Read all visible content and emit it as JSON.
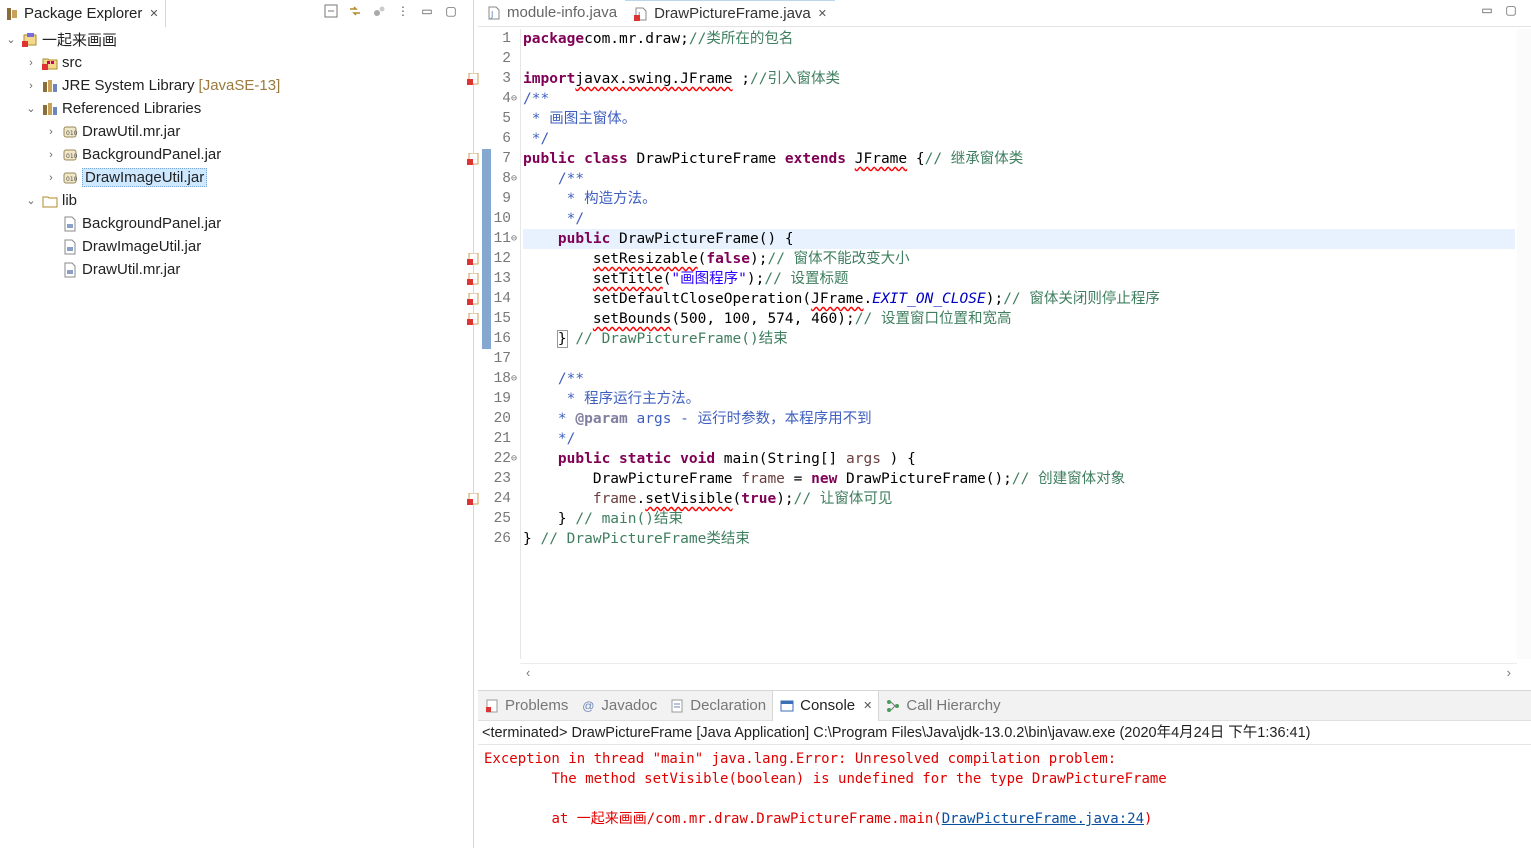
{
  "package_explorer": {
    "title": "Package Explorer",
    "tree": [
      {
        "label": "一起来画画",
        "depth": 0,
        "expanded": true,
        "icon": "java-project-error-icon"
      },
      {
        "label": "src",
        "depth": 1,
        "expanded": false,
        "icon": "source-folder-error-icon"
      },
      {
        "label": "JRE System Library",
        "suffix": "[JavaSE-13]",
        "depth": 1,
        "expanded": false,
        "icon": "library-icon"
      },
      {
        "label": "Referenced Libraries",
        "depth": 1,
        "expanded": true,
        "icon": "library-icon"
      },
      {
        "label": "DrawUtil.mr.jar",
        "depth": 2,
        "expanded": false,
        "icon": "jar-icon"
      },
      {
        "label": "BackgroundPanel.jar",
        "depth": 2,
        "expanded": false,
        "icon": "jar-icon"
      },
      {
        "label": "DrawImageUtil.jar",
        "depth": 2,
        "expanded": false,
        "icon": "jar-icon",
        "selected": true
      },
      {
        "label": "lib",
        "depth": 1,
        "expanded": true,
        "icon": "folder-icon"
      },
      {
        "label": "BackgroundPanel.jar",
        "depth": 2,
        "icon": "jar-file-icon"
      },
      {
        "label": "DrawImageUtil.jar",
        "depth": 2,
        "icon": "jar-file-icon"
      },
      {
        "label": "DrawUtil.mr.jar",
        "depth": 2,
        "icon": "jar-file-icon"
      }
    ]
  },
  "editor": {
    "tabs": [
      {
        "label": "module-info.java",
        "active": false
      },
      {
        "label": "DrawPictureFrame.java",
        "active": true
      }
    ],
    "lines": [
      {
        "n": "1",
        "tokens": [
          [
            "kw",
            "package"
          ],
          [
            "",
            "com.mr.draw;"
          ],
          [
            "cm",
            "//类所在的包名"
          ]
        ]
      },
      {
        "n": "2",
        "tokens": []
      },
      {
        "n": "3",
        "error": true,
        "tokens": [
          [
            "kw",
            "import"
          ],
          [
            "err",
            "javax.swing.JFrame"
          ],
          [
            "",
            " ;"
          ],
          [
            "cm",
            "//引入窗体类"
          ]
        ]
      },
      {
        "n": "4",
        "fold": true,
        "tokens": [
          [
            "jd",
            "/**"
          ]
        ]
      },
      {
        "n": "5",
        "tokens": [
          [
            "jd",
            " * 画图主窗体。"
          ]
        ]
      },
      {
        "n": "6",
        "tokens": [
          [
            "jd",
            " */"
          ]
        ]
      },
      {
        "n": "7",
        "error": true,
        "tokens": [
          [
            "kw",
            "public class"
          ],
          [
            "",
            " DrawPictureFrame "
          ],
          [
            "kw",
            "extends"
          ],
          [
            "",
            " "
          ],
          [
            "err",
            "JFrame"
          ],
          [
            "",
            " {"
          ],
          [
            "cm",
            "// 继承窗体类"
          ]
        ]
      },
      {
        "n": "8",
        "fold": true,
        "tokens": [
          [
            "jd",
            "    /**"
          ]
        ]
      },
      {
        "n": "9",
        "tokens": [
          [
            "jd",
            "     * 构造方法。"
          ]
        ]
      },
      {
        "n": "10",
        "tokens": [
          [
            "jd",
            "     */"
          ]
        ]
      },
      {
        "n": "11",
        "fold": true,
        "hl": true,
        "tokens": [
          [
            "",
            "    "
          ],
          [
            "kw",
            "public"
          ],
          [
            "",
            " DrawPictureFrame() {"
          ]
        ]
      },
      {
        "n": "12",
        "error": true,
        "tokens": [
          [
            "",
            "        "
          ],
          [
            "err",
            "setResizable"
          ],
          [
            "",
            "("
          ],
          [
            "kw",
            "false"
          ],
          [
            "",
            ");"
          ],
          [
            "cm",
            "// 窗体不能改变大小"
          ]
        ]
      },
      {
        "n": "13",
        "error": true,
        "tokens": [
          [
            "",
            "        "
          ],
          [
            "err",
            "setTitle"
          ],
          [
            "",
            "("
          ],
          [
            "str",
            "\"画图程序\""
          ],
          [
            "",
            ");"
          ],
          [
            "cm",
            "// 设置标题"
          ]
        ]
      },
      {
        "n": "14",
        "error": true,
        "tokens": [
          [
            "",
            "        setDefaultCloseOperation("
          ],
          [
            "err",
            "JFrame"
          ],
          [
            "",
            "."
          ],
          [
            "field",
            "EXIT_ON_CLOSE"
          ],
          [
            "",
            ");"
          ],
          [
            "cm",
            "// 窗体关闭则停止程序"
          ]
        ]
      },
      {
        "n": "15",
        "error": true,
        "tokens": [
          [
            "",
            "        "
          ],
          [
            "err",
            "setBounds"
          ],
          [
            "",
            "(500, 100, 574, 460);"
          ],
          [
            "cm",
            "// 设置窗口位置和宽高"
          ]
        ]
      },
      {
        "n": "16",
        "tokens": [
          [
            "",
            "    "
          ],
          [
            "box",
            "}"
          ],
          [
            "cm",
            " // DrawPictureFrame()结束"
          ]
        ]
      },
      {
        "n": "17",
        "tokens": []
      },
      {
        "n": "18",
        "fold": true,
        "tokens": [
          [
            "jd",
            "    /**"
          ]
        ]
      },
      {
        "n": "19",
        "tokens": [
          [
            "jd",
            "     * 程序运行主方法。"
          ]
        ]
      },
      {
        "n": "20",
        "tokens": [
          [
            "jd",
            "    * "
          ],
          [
            "tag",
            "@param"
          ],
          [
            "jd",
            " args - 运行时参数，本程序用不到"
          ]
        ]
      },
      {
        "n": "21",
        "tokens": [
          [
            "jd",
            "    */"
          ]
        ]
      },
      {
        "n": "22",
        "fold": true,
        "tokens": [
          [
            "",
            "    "
          ],
          [
            "kw",
            "public static void"
          ],
          [
            "",
            " main(String[] "
          ],
          [
            "var",
            "args"
          ],
          [
            "",
            " ) {"
          ]
        ]
      },
      {
        "n": "23",
        "tokens": [
          [
            "",
            "        DrawPictureFrame "
          ],
          [
            "var",
            "frame"
          ],
          [
            "",
            " = "
          ],
          [
            "kw",
            "new"
          ],
          [
            "",
            " DrawPictureFrame();"
          ],
          [
            "cm",
            "// 创建窗体对象"
          ]
        ]
      },
      {
        "n": "24",
        "error": true,
        "tokens": [
          [
            "",
            "        "
          ],
          [
            "var",
            "frame"
          ],
          [
            "",
            "."
          ],
          [
            "err",
            "setVisible"
          ],
          [
            "",
            "("
          ],
          [
            "kw",
            "true"
          ],
          [
            "",
            ");"
          ],
          [
            "cm",
            "// 让窗体可见"
          ]
        ]
      },
      {
        "n": "25",
        "tokens": [
          [
            "",
            "    } "
          ],
          [
            "cm",
            "// main()结束"
          ]
        ]
      },
      {
        "n": "26",
        "tokens": [
          [
            "",
            "} "
          ],
          [
            "cm",
            "// DrawPictureFrame类结束"
          ]
        ]
      }
    ]
  },
  "bottom_panel": {
    "tabs": [
      {
        "label": "Problems",
        "icon": "problems-icon",
        "active": false
      },
      {
        "label": "Javadoc",
        "icon": "javadoc-icon",
        "active": false
      },
      {
        "label": "Declaration",
        "icon": "declaration-icon",
        "active": false
      },
      {
        "label": "Console",
        "icon": "console-icon",
        "active": true
      },
      {
        "label": "Call Hierarchy",
        "icon": "call-hierarchy-icon",
        "active": false
      }
    ],
    "console_status": "<terminated> DrawPictureFrame [Java Application] C:\\Program Files\\Java\\jdk-13.0.2\\bin\\javaw.exe (2020年4月24日 下午1:36:41)",
    "console_lines": [
      "Exception in thread \"main\" java.lang.Error: Unresolved compilation problem: ",
      "\tThe method setVisible(boolean) is undefined for the type DrawPictureFrame",
      "",
      "\tat 一起来画画/com.mr.draw.DrawPictureFrame.main("
    ],
    "console_link": "DrawPictureFrame.java:24",
    "console_link_tail": ")"
  },
  "colors": {
    "keyword": "#7f0055",
    "comment": "#3f7f5f",
    "javadoc": "#3f5fbf",
    "string": "#2a00ff",
    "error_text": "#e00000",
    "selection": "#cde8ff",
    "current_line": "#e8f2fe"
  }
}
